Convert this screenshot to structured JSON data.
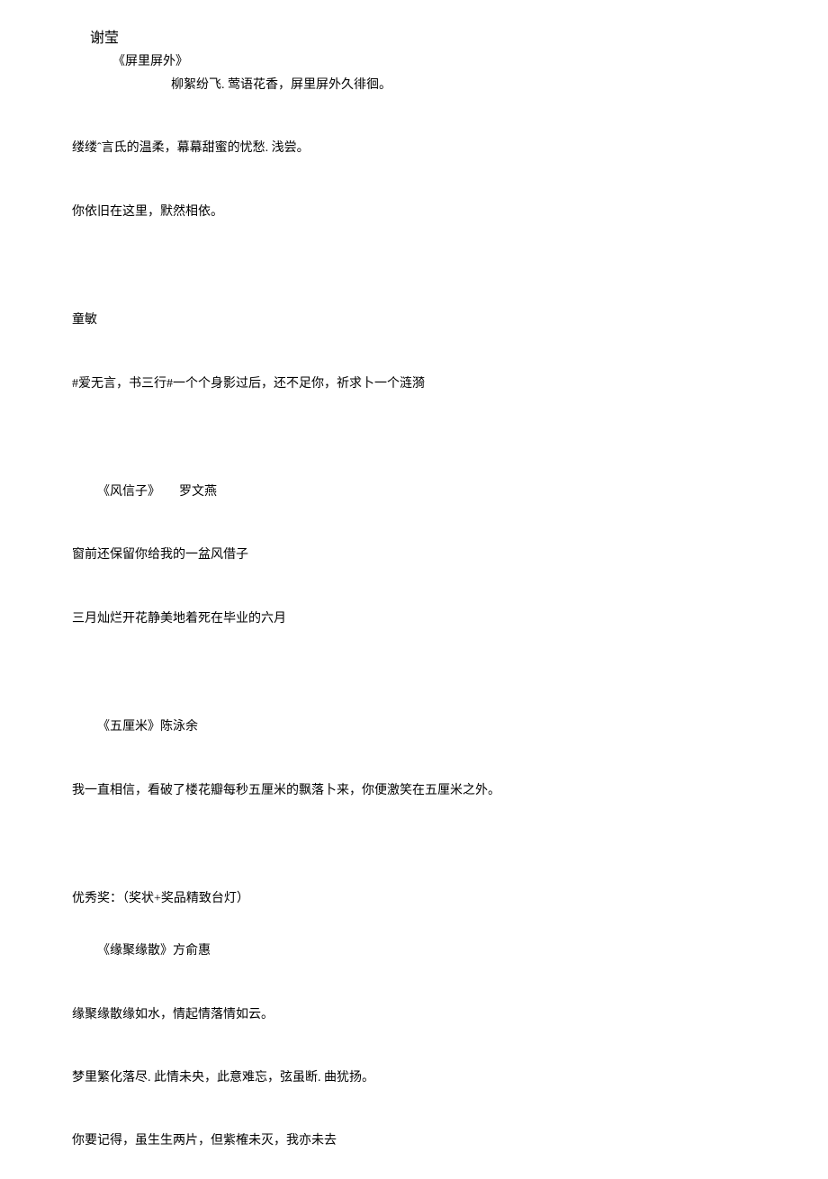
{
  "poem1": {
    "author": "谢莹",
    "title": "《屏里屏外》",
    "line1": "柳絮纷飞. 莺语花香，屏里屏外久徘徊。",
    "line2": "缕缕ˆ言氐的温柔，幕幕甜蜜的忧愁. 浅尝。",
    "line3": "你依旧在这里，默然相依。"
  },
  "poem2": {
    "author": "童敏",
    "line1": "#爱无言，书三行#一个个身影过后，还不足你，祈求卜一个涟漪"
  },
  "poem3": {
    "title_author": "《风信子》　　罗文燕",
    "line1": "窗前还保留你给我的一盆风借子",
    "line2": "三月灿烂开花静美地着死在毕业的六月"
  },
  "poem4": {
    "title_author": "《五厘米》陈泳余",
    "line1": "我一直相信，看破了楼花瓣每秒五厘米的飘落卜来，你便激笑在五厘米之外。"
  },
  "award": {
    "label": "优秀奖：（奖状+奖品精致台灯）"
  },
  "poem5": {
    "title_author": "《缘聚缘散》方俞惠",
    "line1": "缘聚缘散缘如水，情起情落情如云。",
    "line2": "梦里繁化落尽. 此情未央，此意难忘，弦虽断. 曲犹扬。",
    "line3": "你要记得，虽生生两片，但紫榷未灭，我亦未去"
  }
}
